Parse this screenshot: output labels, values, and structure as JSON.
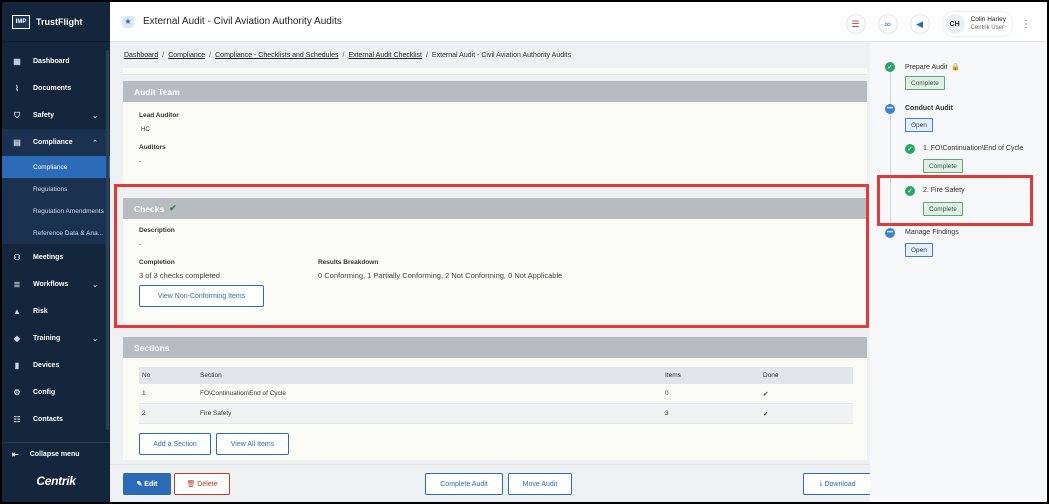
{
  "app": {
    "logo_mark": "IMP",
    "logo_name": "TrustFlight",
    "brand": "Centrik"
  },
  "sidebar": {
    "items": [
      {
        "label": "Dashboard",
        "icon": "dashboard-icon"
      },
      {
        "label": "Documents",
        "icon": "paperclip-icon"
      },
      {
        "label": "Safety",
        "icon": "shield-icon"
      },
      {
        "label": "Compliance",
        "icon": "clipboard-icon"
      },
      {
        "label": "Meetings",
        "icon": "meetings-icon"
      },
      {
        "label": "Workflows",
        "icon": "workflow-icon"
      },
      {
        "label": "Risk",
        "icon": "risk-icon"
      },
      {
        "label": "Training",
        "icon": "graduation-cap-icon"
      },
      {
        "label": "Devices",
        "icon": "devices-icon"
      },
      {
        "label": "Config",
        "icon": "config-icon"
      },
      {
        "label": "Contacts",
        "icon": "contacts-icon"
      }
    ],
    "compliance_sub": [
      "Compliance",
      "Regulations",
      "Regulation Amendments",
      "Reference Data & Ana..."
    ],
    "collapse_label": "Collapse menu"
  },
  "header": {
    "title": "External Audit",
    "subtitle": "Civil Aviation Authority Audits",
    "separator": "-",
    "user_initials": "CH",
    "user_name": "Colin Harley",
    "user_role": "Centrik User"
  },
  "breadcrumb": {
    "links": [
      "Dashboard",
      "Compliance",
      "Compliance - Checklists and Schedules",
      "External Audit Checklist"
    ],
    "current": "External Audit - Civil Aviation Authority Audits"
  },
  "audit_team": {
    "heading": "Audit Team",
    "lead_label": "Lead Auditor",
    "lead_value": "HC",
    "auditors_label": "Auditors",
    "auditors_value": "-"
  },
  "checks": {
    "heading": "Checks",
    "description_label": "Description",
    "description_value": "-",
    "completion_label": "Completion",
    "completion_value": "3 of 3 checks completed",
    "results_label": "Results Breakdown",
    "results_value": "0 Conforming, 1 Partially Conforming, 2 Not Conforming, 0 Not Applicable",
    "view_nc_button": "View Non-Conforming Items"
  },
  "sections": {
    "heading": "Sections",
    "columns": [
      "No",
      "Section",
      "Items",
      "Done"
    ],
    "rows": [
      {
        "no": "1",
        "section": "FO\\Continuation\\End of Cycle",
        "items": "0",
        "done": "✔"
      },
      {
        "no": "2",
        "section": "Fire Safety",
        "items": "3",
        "done": "✔"
      }
    ],
    "add_button": "Add a Section",
    "view_all_button": "View All Items"
  },
  "footer": {
    "edit": "Edit",
    "delete": "Delete",
    "complete_audit": "Complete Audit",
    "move_audit": "Move Audit",
    "download": "Download"
  },
  "workflow": {
    "prepare": {
      "label": "Prepare Audit",
      "status": "Complete"
    },
    "conduct": {
      "label": "Conduct Audit",
      "status": "Open"
    },
    "step1": {
      "label": "1. FO\\Continuation\\End of Cycle",
      "status": "Complete"
    },
    "step2": {
      "label": "2. Fire Safety",
      "status": "Complete"
    },
    "findings": {
      "label": "Manage Findings",
      "status": "Open"
    }
  },
  "colors": {
    "primary": "#2b6bb8",
    "sidebar": "#14263c",
    "highlight": "#e53935",
    "success": "#27a66a"
  }
}
